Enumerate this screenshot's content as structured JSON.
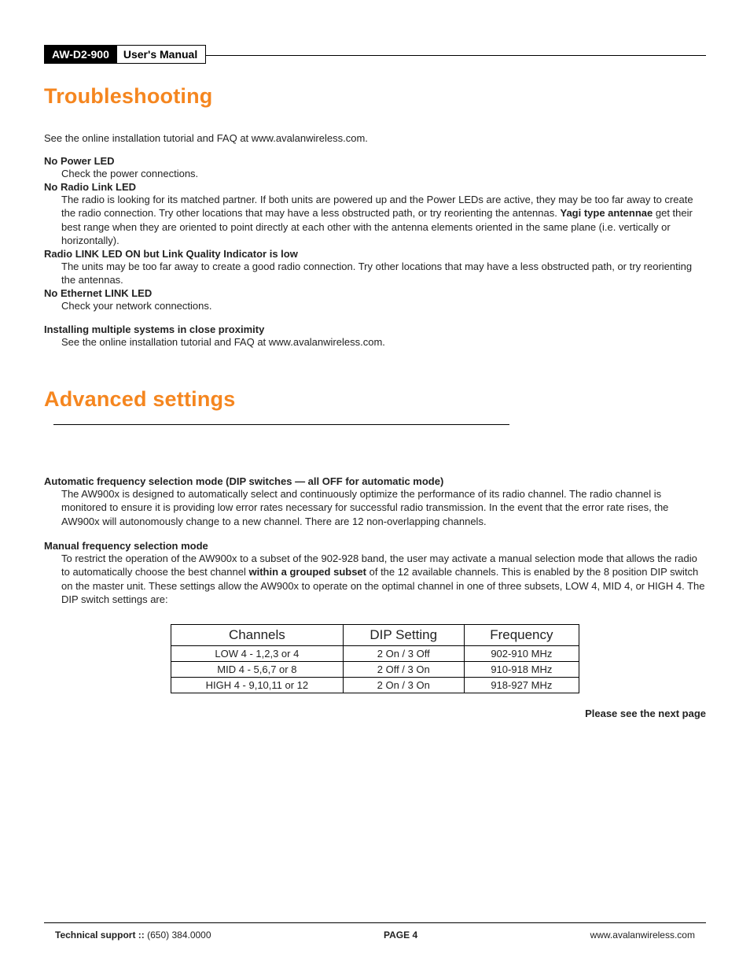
{
  "header": {
    "model": "AW-D2-900",
    "title": "User's Manual"
  },
  "sections": {
    "troubleshooting": {
      "heading": "Troubleshooting",
      "intro": "See the online installation tutorial and FAQ at www.avalanwireless.com.",
      "items": [
        {
          "heading": "No Power LED",
          "body_parts": [
            "Check the power connections."
          ]
        },
        {
          "heading": "No Radio Link LED",
          "body_parts": [
            "The radio is looking for its matched partner. If both units are powered up and the Power LEDs are active, they may be too far away to create the radio connection. Try other locations that may have a less obstructed path, or try reorienting the antennas. ",
            "Yagi type antennae",
            " get their best range when they are oriented to point directly at each other with the antenna elements oriented in the same plane (i.e. vertically or horizontally)."
          ],
          "bold_index": 1
        },
        {
          "heading": "Radio LINK LED ON but Link Quality Indicator is low",
          "body_parts": [
            "The units may be too far away to create a good radio connection. Try other locations that may have a less obstructed path, or try reorienting the antennas."
          ]
        },
        {
          "heading": "No Ethernet LINK LED",
          "body_parts": [
            "Check your network connections."
          ]
        },
        {
          "heading": "Installing multiple systems in close proximity",
          "body_parts": [
            "See the online installation tutorial and FAQ at www.avalanwireless.com."
          ],
          "gap_before": true
        }
      ]
    },
    "advanced": {
      "heading": "Advanced settings",
      "items": [
        {
          "heading": "Automatic frequency selection mode (DIP switches — all OFF for automatic mode)",
          "body_parts": [
            "The AW900x is designed to automatically select and continuously optimize the performance of its radio channel. The radio channel is monitored to ensure it is providing low error rates necessary for successful radio transmission. In the event that the error rate rises, the AW900x will autonomously change to a new channel. There are 12 non-overlapping channels."
          ]
        },
        {
          "heading": "Manual frequency selection mode",
          "body_parts": [
            "To restrict the operation of the AW900x to a subset of the 902-928 band, the user may activate a manual selection mode that allows the radio to automatically choose the best channel ",
            "within a grouped subset",
            " of the 12 available channels. This is enabled by the 8 position DIP switch on the master unit. These settings allow the AW900x to operate on the optimal channel in one of three subsets, LOW 4, MID 4, or HIGH 4. The DIP switch settings are:"
          ],
          "bold_index": 1
        }
      ],
      "next_page": "Please see the next page"
    }
  },
  "chart_data": {
    "type": "table",
    "columns": [
      "Channels",
      "DIP Setting",
      "Frequency"
    ],
    "rows": [
      [
        "LOW 4 - 1,2,3 or 4",
        "2 On / 3 Off",
        "902-910 MHz"
      ],
      [
        "MID 4 - 5,6,7 or 8",
        "2 Off / 3 On",
        "910-918 MHz"
      ],
      [
        "HIGH 4 - 9,10,11 or 12",
        "2 On / 3 On",
        "918-927 MHz"
      ]
    ]
  },
  "footer": {
    "support_label": "Technical support :: ",
    "support_phone": "(650) 384.0000",
    "page_label": "PAGE 4",
    "url": "www.avalanwireless.com"
  }
}
